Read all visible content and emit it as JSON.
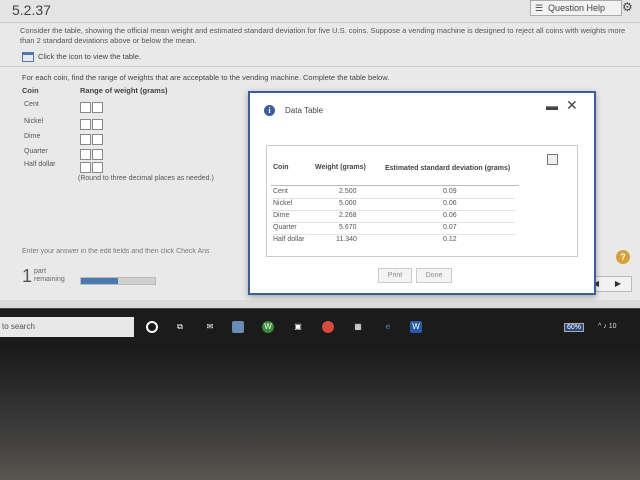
{
  "header": {
    "exercise_number": "5.2.37",
    "question_help": "Question Help"
  },
  "problem_text": "Consider the table, showing the official mean weight and estimated standard deviation for five U.S. coins. Suppose a vending machine is designed to reject all coins with weights more than 2 standard deviations above or below the mean.",
  "view_table_link": "Click the icon to view the table.",
  "instruction": "For each coin, find the range of weights that are acceptable to the vending machine. Complete the table below.",
  "answer_table": {
    "col_coin": "Coin",
    "col_range": "Range of weight (grams)",
    "coins": [
      "Cent",
      "Nickel",
      "Dime",
      "Quarter",
      "Half dollar"
    ],
    "round_note": "(Round to three decimal places as needed.)"
  },
  "enter_answer": "Enter your answer in the edit fields and then click Check Ans",
  "part": {
    "number": "1",
    "label_line1": "part",
    "label_line2": "remaining",
    "progress_fraction": 0.5
  },
  "modal": {
    "title": "Data Table",
    "headers": {
      "coin": "Coin",
      "weight": "Weight (grams)",
      "sd": "Estimated standard deviation (grams)"
    },
    "rows": [
      {
        "coin": "Cent",
        "weight": "2.500",
        "sd": "0.09"
      },
      {
        "coin": "Nickel",
        "weight": "5.000",
        "sd": "0.06"
      },
      {
        "coin": "Dime",
        "weight": "2.268",
        "sd": "0.06"
      },
      {
        "coin": "Quarter",
        "weight": "5.670",
        "sd": "0.07"
      },
      {
        "coin": "Half dollar",
        "weight": "11.340",
        "sd": "0.12"
      }
    ],
    "print_label": "Print",
    "done_label": "Done"
  },
  "taskbar": {
    "search_text": "to search",
    "battery": "60%",
    "tray_text": "10"
  },
  "colors": {
    "accent": "#3b5d9e",
    "help_badge": "#d8a13a"
  }
}
